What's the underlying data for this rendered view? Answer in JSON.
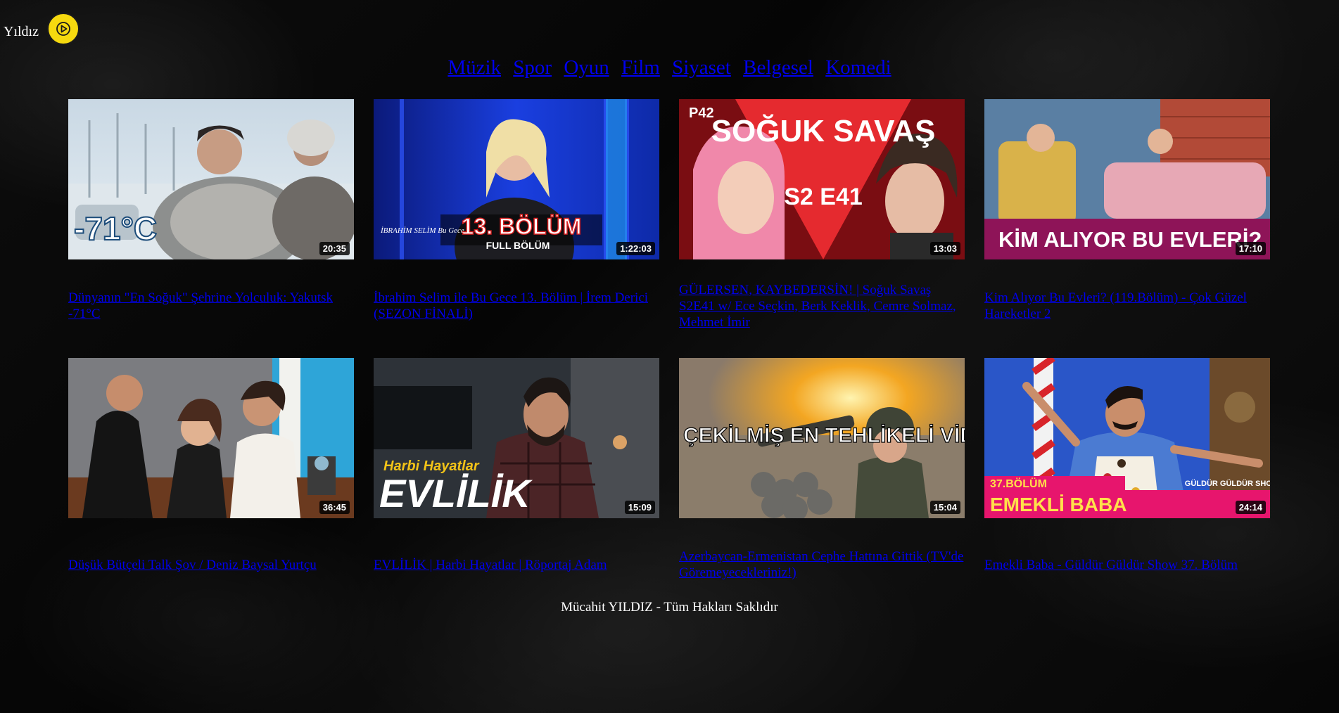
{
  "header": {
    "brand": "Yıldız",
    "play_icon": "play-circle-icon",
    "accent_color": "#f6d90f"
  },
  "nav": {
    "items": [
      "Müzik",
      "Spor",
      "Oyun",
      "Film",
      "Siyaset",
      "Belgesel",
      "Komedi"
    ]
  },
  "videos": [
    {
      "title": "Dünyanın \"En Soğuk\" Şehrine Yolculuk: Yakutsk -71°C",
      "duration": "20:35",
      "overlay_text": "-71°C"
    },
    {
      "title": "İbrahim Selim ile Bu Gece 13. Bölüm | İrem Derici (SEZON FİNALİ)",
      "duration": "1:22:03",
      "overlay_text": "13. BÖLÜM",
      "overlay_sub": "FULL BÖLÜM",
      "overlay_logo": "İBRAHİM SELİM Bu Gece"
    },
    {
      "title": "GÜLERSEN, KAYBEDERSİN! | Soğuk Savaş S2E41 w/ Ece Seçkin, Berk Keklik, Cemre Solmaz, Mehmet İmir",
      "duration": "13:03",
      "overlay_text": "SOĞUK SAVAŞ",
      "overlay_sub": "S2 E41",
      "overlay_logo": "P42"
    },
    {
      "title": "Kim Alıyor Bu Evleri? (119.Bölüm) - Çok Güzel Hareketler 2",
      "duration": "17:10",
      "overlay_text": "KİM ALIYOR BU EVLERİ?"
    },
    {
      "title": "Düşük Bütçeli Talk Şov / Deniz Baysal Yurtçu",
      "duration": "36:45",
      "overlay_text": ""
    },
    {
      "title": "EVLİLİK | Harbi Hayatlar | Röportaj Adam",
      "duration": "15:09",
      "overlay_text": "EVLİLİK",
      "overlay_sub": "Harbi Hayatlar"
    },
    {
      "title": "Azerbaycan-Ermenistan Cephe Hattına Gittik (TV'de Göremeyecekleriniz!)",
      "duration": "15:04",
      "overlay_text": "ÇEKİLMİŞ EN TEHLİKELİ VİDEO"
    },
    {
      "title": "Emekli Baba - Güldür Güldür Show 37. Bölüm",
      "duration": "24:14",
      "overlay_text": "EMEKLİ BABA",
      "overlay_sub": "37.BÖLÜM",
      "overlay_logo": "GÜLDÜR GÜLDÜR SHOW"
    }
  ],
  "footer": {
    "text": "Mücahit YILDIZ - Tüm Hakları Saklıdır"
  }
}
